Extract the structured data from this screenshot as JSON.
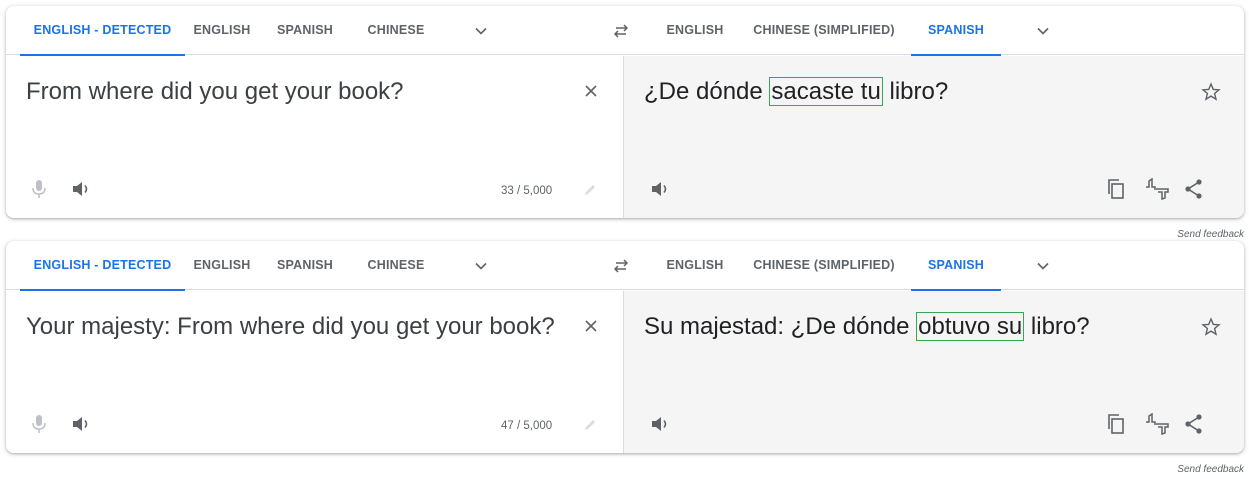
{
  "panels": [
    {
      "source_tabs": [
        "ENGLISH - DETECTED",
        "ENGLISH",
        "SPANISH",
        "CHINESE"
      ],
      "target_tabs": [
        "ENGLISH",
        "CHINESE (SIMPLIFIED)",
        "SPANISH"
      ],
      "source_text": "From where did you get your book?",
      "target_pre": "¿De dónde ",
      "target_highlight": "sacaste tu",
      "target_post": " libro?",
      "char_count": "33 / 5,000",
      "feedback": "Send feedback"
    },
    {
      "source_tabs": [
        "ENGLISH - DETECTED",
        "ENGLISH",
        "SPANISH",
        "CHINESE"
      ],
      "target_tabs": [
        "ENGLISH",
        "CHINESE (SIMPLIFIED)",
        "SPANISH"
      ],
      "source_text": "Your majesty: From where did you get your book?",
      "target_pre": "Su majestad: ¿De dónde ",
      "target_highlight": "obtuvo su",
      "target_post": " libro?",
      "char_count": "47 / 5,000",
      "feedback": "Send feedback"
    }
  ],
  "colors": {
    "accent": "#1a73e8",
    "highlight_border": "#34a853"
  }
}
